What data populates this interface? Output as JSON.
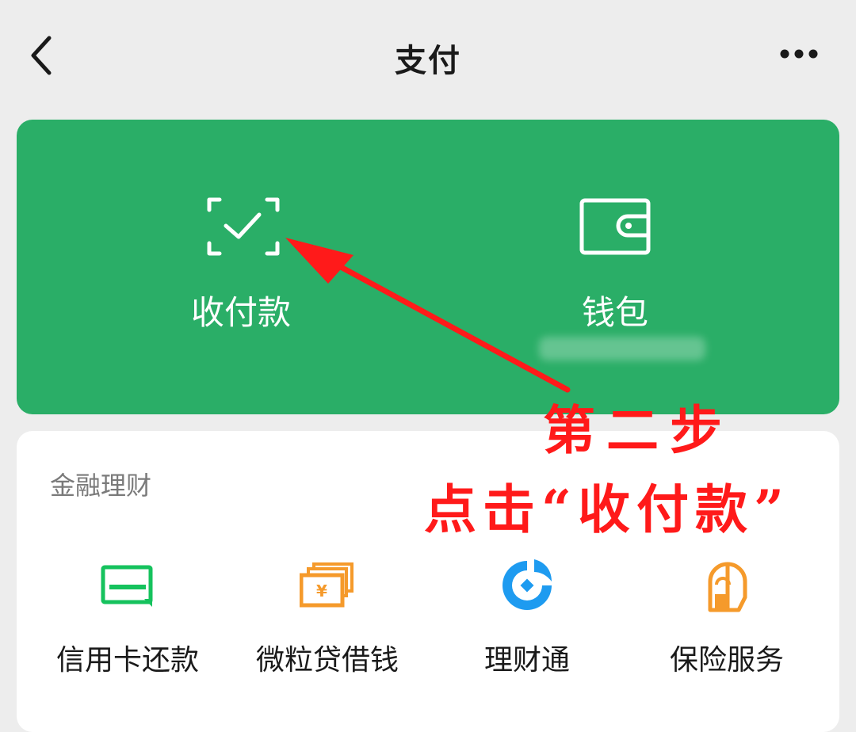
{
  "header": {
    "title": "支付",
    "back_icon": "chevron-left-icon",
    "more_icon": "more-dots-icon"
  },
  "main_card": {
    "accent_color": "#2aae67",
    "items": [
      {
        "label": "收付款",
        "icon": "scan-check-icon"
      },
      {
        "label": "钱包",
        "icon": "wallet-icon"
      }
    ]
  },
  "finance": {
    "section_title": "金融理财",
    "items": [
      {
        "label": "信用卡还款",
        "icon": "credit-card-icon",
        "color": "#15c25d"
      },
      {
        "label": "微粒贷借钱",
        "icon": "yuan-notes-icon",
        "color": "#f59a2b"
      },
      {
        "label": "理财通",
        "icon": "licaitong-icon",
        "color": "#1e9bf0"
      },
      {
        "label": "保险服务",
        "icon": "insurance-icon",
        "color": "#f59a2b"
      }
    ]
  },
  "annotation": {
    "step": "第二步",
    "instruction": "点击“收付款”",
    "color": "#ff1a1a"
  }
}
